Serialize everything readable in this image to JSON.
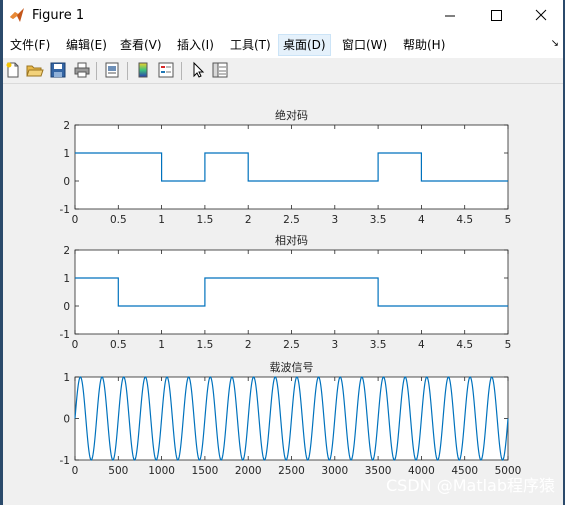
{
  "window": {
    "title": "Figure 1"
  },
  "menu": [
    {
      "label": "文件(F)"
    },
    {
      "label": "编辑(E)"
    },
    {
      "label": "查看(V)"
    },
    {
      "label": "插入(I)"
    },
    {
      "label": "工具(T)"
    },
    {
      "label": "桌面(D)",
      "active": true
    },
    {
      "label": "窗口(W)"
    },
    {
      "label": "帮助(H)"
    }
  ],
  "toolbar": [
    "new-figure-icon",
    "open-file-icon",
    "save-icon",
    "print-icon",
    "print-preview-icon",
    "colorbar-icon",
    "legend-icon",
    "edit-plot-pointer-icon",
    "property-inspector-icon"
  ],
  "watermark": "CSDN @Matlab程序猿",
  "chart_data": [
    {
      "type": "line",
      "title": "绝对码",
      "xlim": [
        0,
        5
      ],
      "ylim": [
        -1,
        2
      ],
      "xticks": [
        "0",
        "0.5",
        "1",
        "1.5",
        "2",
        "2.5",
        "3",
        "3.5",
        "4",
        "4.5",
        "5"
      ],
      "yticks": [
        "-1",
        "0",
        "1",
        "2"
      ],
      "step": true,
      "x": [
        0,
        1,
        1,
        1.5,
        1.5,
        2,
        2,
        3.5,
        3.5,
        4,
        4,
        5
      ],
      "y": [
        1,
        1,
        0,
        0,
        1,
        1,
        0,
        0,
        1,
        1,
        0,
        0
      ],
      "color": "#0072bd"
    },
    {
      "type": "line",
      "title": "相对码",
      "xlim": [
        0,
        5
      ],
      "ylim": [
        -1,
        2
      ],
      "xticks": [
        "0",
        "0.5",
        "1",
        "1.5",
        "2",
        "2.5",
        "3",
        "3.5",
        "4",
        "4.5",
        "5"
      ],
      "yticks": [
        "-1",
        "0",
        "1",
        "2"
      ],
      "step": true,
      "x": [
        0,
        0.5,
        0.5,
        1.5,
        1.5,
        3.5,
        3.5,
        5
      ],
      "y": [
        1,
        1,
        0,
        0,
        1,
        1,
        0,
        0
      ],
      "color": "#0072bd"
    },
    {
      "type": "line",
      "title": "载波信号",
      "xlim": [
        0,
        5000
      ],
      "ylim": [
        -1,
        1
      ],
      "xticks": [
        "0",
        "500",
        "1000",
        "1500",
        "2000",
        "2500",
        "3000",
        "3500",
        "4000",
        "4500",
        "5000"
      ],
      "yticks": [
        "-1",
        "0",
        "1"
      ],
      "signal": "sin",
      "cycles": 20,
      "color": "#0072bd"
    }
  ]
}
